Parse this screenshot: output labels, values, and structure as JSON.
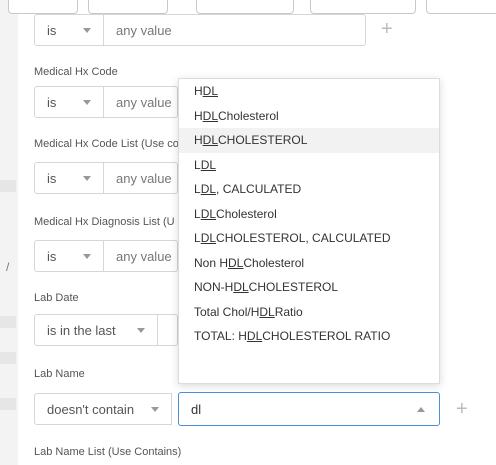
{
  "form": {
    "filters": [
      {
        "operator": "is",
        "value": "any value"
      },
      {
        "label": "Medical Hx Code",
        "operator": "is",
        "value": "any value"
      },
      {
        "label": "Medical Hx Code List (Use co",
        "operator": "is",
        "value": "any value"
      },
      {
        "label": "Medical Hx Diagnosis List (U",
        "operator": "is",
        "value": "any value"
      },
      {
        "label": "Lab Date",
        "operator": "is in the last"
      },
      {
        "label": "Lab Name",
        "operator": "doesn't contain",
        "value": "dl"
      },
      {
        "label": "Lab Name List (Use Contains)"
      }
    ],
    "add_icon": "+"
  },
  "dropdown": {
    "query": "dl",
    "highlighted_index": 2,
    "options": [
      {
        "pre": "H",
        "match": "DL",
        "post": ""
      },
      {
        "pre": "H",
        "match": "DL",
        "post": " Cholesterol"
      },
      {
        "pre": "H",
        "match": "DL",
        "post": " CHOLESTEROL"
      },
      {
        "pre": "L",
        "match": "DL",
        "post": ""
      },
      {
        "pre": "L",
        "match": "DL",
        "post": ", CALCULATED"
      },
      {
        "pre": "L",
        "match": "DL",
        "post": " Cholesterol"
      },
      {
        "pre": "L",
        "match": "DL",
        "post": " CHOLESTEROL, CALCULATED"
      },
      {
        "pre": "Non H",
        "match": "DL",
        "post": " Cholesterol"
      },
      {
        "pre": "NON-H",
        "match": "DL",
        "post": " CHOLESTEROL"
      },
      {
        "pre": "Total Chol/H",
        "match": "DL",
        "post": " Ratio"
      },
      {
        "pre": "TOTAL: H",
        "match": "DL",
        "post": " CHOLESTEROL RATIO"
      }
    ]
  },
  "sidebar_glyph": "/",
  "colors": {
    "accent": "#4a90d9",
    "border": "#d6d6d6",
    "highlight": "#f2f2f2"
  }
}
